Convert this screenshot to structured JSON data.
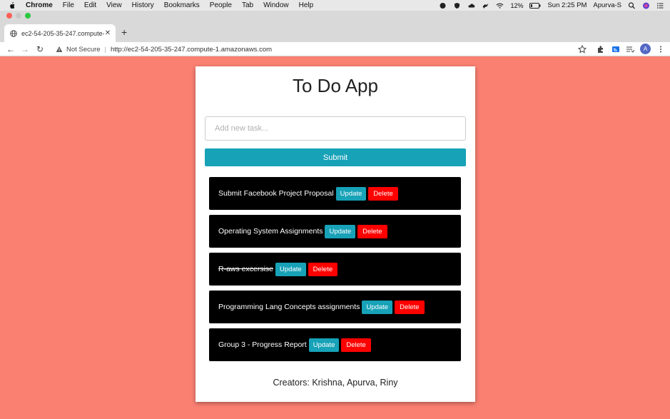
{
  "menubar": {
    "app_name": "Chrome",
    "items": [
      "File",
      "Edit",
      "View",
      "History",
      "Bookmarks",
      "People",
      "Tab",
      "Window",
      "Help"
    ],
    "battery": "12%",
    "clock": "Sun 2:25 PM",
    "user": "Apurva-S"
  },
  "browser": {
    "tab_title": "ec2-54-205-35-247.compute-1.amazonaws.com",
    "security_label": "Not Secure",
    "url": "http://ec2-54-205-35-247.compute-1.amazonaws.com",
    "avatar_letter": "A",
    "icons": [
      "apple-icon",
      "globe-icon",
      "close-icon",
      "new-tab-icon",
      "back-icon",
      "forward-icon",
      "reload-icon",
      "warning-icon",
      "star-icon",
      "extensions-icon",
      "cast-icon",
      "reading-list-icon",
      "more-icon"
    ]
  },
  "app": {
    "title": "To Do App",
    "input_placeholder": "Add new task...",
    "input_value": "",
    "submit_label": "Submit",
    "update_label": "Update",
    "delete_label": "Delete",
    "tasks": [
      {
        "name": "Submit Facebook Project Proposal",
        "completed": false
      },
      {
        "name": "Operating System Assignments",
        "completed": false
      },
      {
        "name": "R-aws excersise",
        "completed": true
      },
      {
        "name": "Programming Lang Concepts assignments",
        "completed": false
      },
      {
        "name": "Group 3 - Progress Report",
        "completed": false
      }
    ],
    "creators": "Creators: Krishna, Apurva, Riny"
  },
  "colors": {
    "page_background": "#fa8072",
    "accent": "#17a2b8",
    "delete": "#ff0000",
    "task_background": "#000000"
  }
}
